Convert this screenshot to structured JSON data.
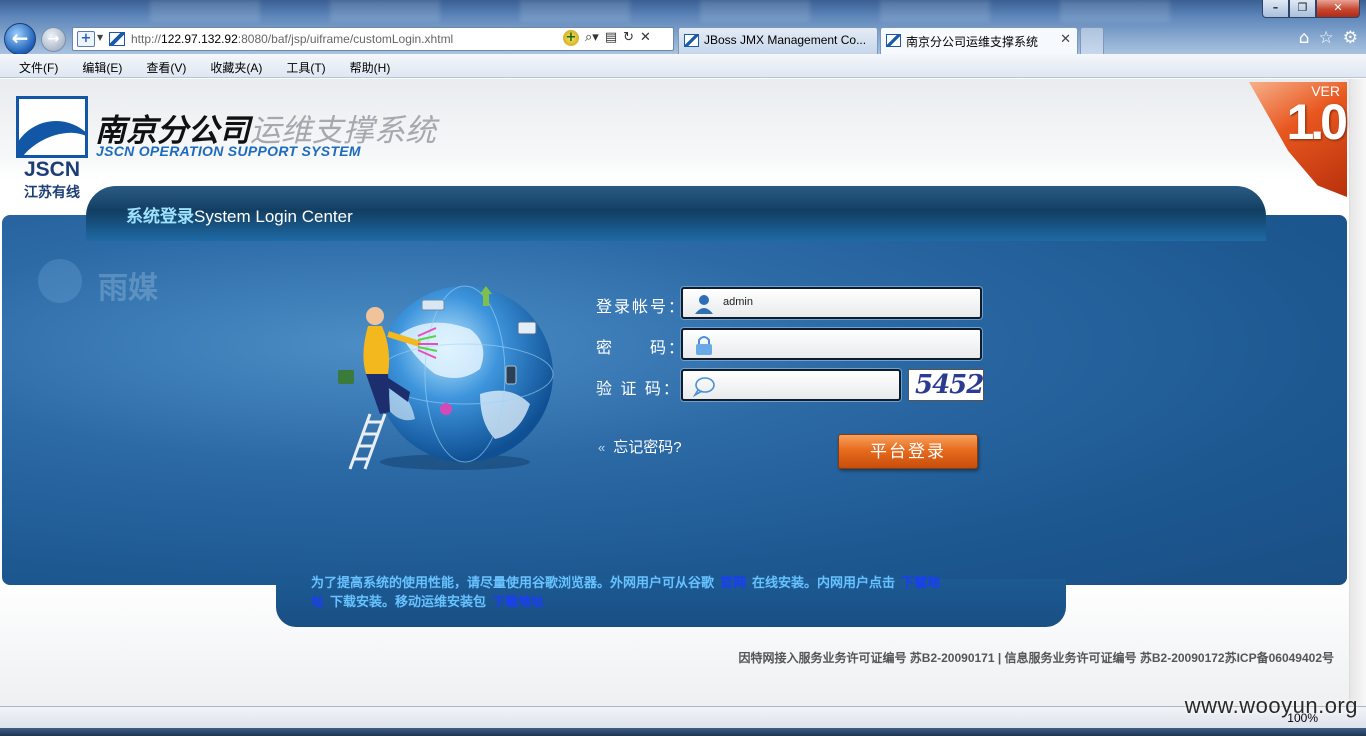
{
  "browser": {
    "address": {
      "url_prefix": "http://",
      "url_host": "122.97.132.92",
      "url_rest": ":8080/baf/jsp/uiframe/customLogin.xhtml"
    },
    "tabs": [
      {
        "label": "JBoss JMX Management Co..."
      },
      {
        "label": "南京分公司运维支撑系统",
        "active": true
      }
    ],
    "menu": [
      "文件(F)",
      "编辑(E)",
      "查看(V)",
      "收藏夹(A)",
      "工具(T)",
      "帮助(H)"
    ],
    "zoom": "100%"
  },
  "header": {
    "logo_text": "JSCN",
    "logo_subtext": "江苏有线",
    "title_part1": "南京分公司",
    "title_part2": "运维支撑系统",
    "subtitle": "JSCN OPERATION SUPPORT SYSTEM",
    "version_label": "VER",
    "version_number": "1.0"
  },
  "banner": {
    "title_cn": "系统登录",
    "title_en": "System Login Center"
  },
  "watermark_logo_text": "雨媒",
  "login": {
    "account_label": "登录帐号：",
    "account_value": "admin",
    "password_label": "密　　码：",
    "password_value": "",
    "captcha_label": "验 证 码：",
    "captcha_value": "",
    "captcha_image_text": "5452",
    "forgot_label": "忘记密码?",
    "submit_label": "平台登录"
  },
  "notice": {
    "part1": "为了提高系统的使用性能，请尽量使用谷歌浏览器。外网用户可从谷歌",
    "link1": "官网",
    "part2": "在线安装。内网用户点击",
    "link2": "下载地址",
    "part3": "下载安装。移动运维安装包",
    "link3": "下载地址"
  },
  "footer": {
    "license": "因特网接入服务业务许可证编号 苏B2-20090171 | 信息服务业务许可证编号 苏B2-20090172苏ICP备06049402号"
  },
  "site_watermark": "www.wooyun.org",
  "colors": {
    "panel_blue": "#1d5891",
    "accent_orange": "#e76c1f",
    "notice_text": "#67c2ff",
    "notice_link": "#1a3cff"
  }
}
